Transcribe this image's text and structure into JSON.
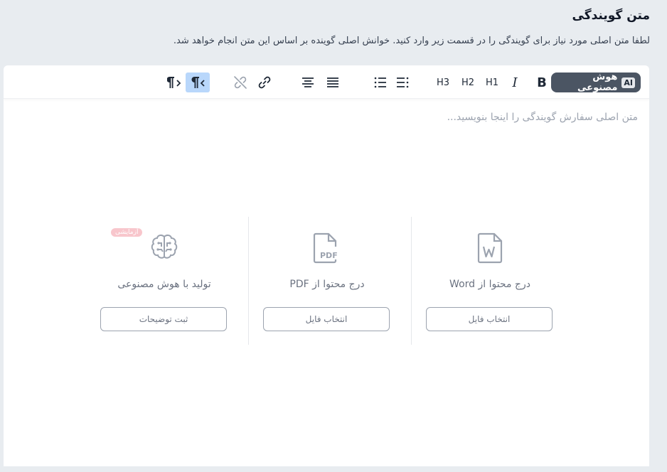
{
  "header": {
    "title": "متن گویندگی",
    "subtitle": "لطفا متن اصلی مورد نیاز برای گویندگی را در قسمت زیر وارد کنید. خوانش اصلی گوینده بر اساس این متن انجام خواهد شد."
  },
  "toolbar": {
    "ai_badge": "AI",
    "ai_label": "هوش مصنوعی",
    "bold": "B",
    "italic": "I",
    "h1": "H1",
    "h2": "H2",
    "h3": "H3"
  },
  "editor": {
    "placeholder": "متن اصلی سفارش گویندگی را اینجا بنویسید..."
  },
  "cards": [
    {
      "icon": "word-file-icon",
      "label": "درج محتوا از Word",
      "button": "انتخاب فایل"
    },
    {
      "icon": "pdf-file-icon",
      "label": "درج محتوا از PDF",
      "button": "انتخاب فایل"
    },
    {
      "icon": "brain-icon",
      "label": "تولید با هوش مصنوعی",
      "button": "ثبت توضیحات",
      "badge": "آزمایشی"
    }
  ],
  "colors": {
    "background": "#e8ecf0",
    "ai_button": "#4b5563",
    "active_tool": "#b9d7fb",
    "beta_badge": "#f8c6cc"
  }
}
